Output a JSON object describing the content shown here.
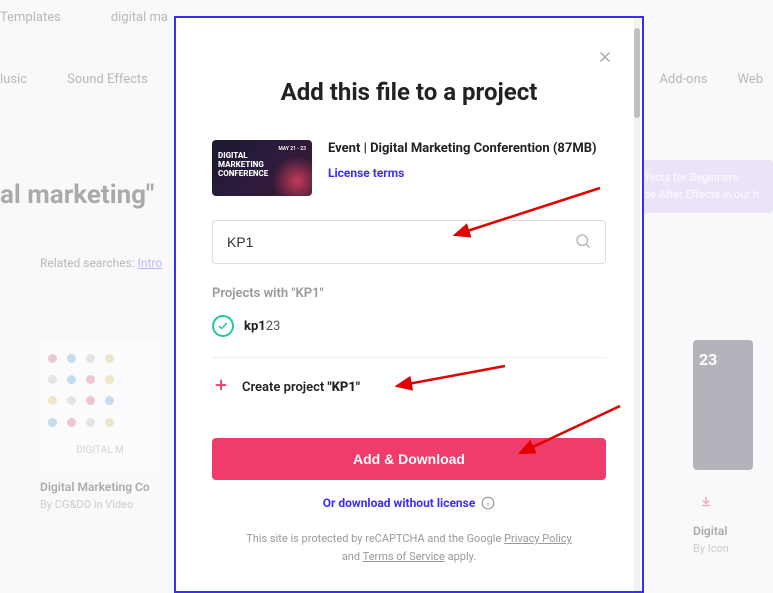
{
  "bg": {
    "nav1": [
      "Templates",
      "digital ma"
    ],
    "nav2": [
      "lusic",
      "Sound Effects"
    ],
    "nav_right": [
      "Add-ons",
      "Web"
    ],
    "heading": "al marketing\"",
    "related_label": "Related searches:",
    "related_link": "Intro",
    "banner_line1": "r Effects for Beginners",
    "banner_line2": "o use After Effects in our h",
    "card_left_thumb": "DIGITAL M",
    "card_left_title": "Digital Marketing Co",
    "card_left_sub": "By CG&DO in Video",
    "card_right_num": "23",
    "card_right_title": "Digital",
    "card_right_sub": "By Icon"
  },
  "modal": {
    "title": "Add this file to a project",
    "file_name": "Event | Digital Marketing Conferention (87MB)",
    "thumb_text": "DIGITAL\nMARKETING\nCONFERENCE",
    "thumb_date": "MAY 21 - 23",
    "license_link": "License terms",
    "search_value": "KP1",
    "projects_label": "Projects with \"KP1\"",
    "project_match_prefix": "kp1",
    "project_match_suffix": "23",
    "create_prefix": "Create project ",
    "create_name": "\"KP1\"",
    "primary_btn": "Add & Download",
    "alt_download": "Or download without license",
    "recaptcha_pre": "This site is protected by reCAPTCHA and the Google ",
    "recaptcha_pp": "Privacy Policy",
    "recaptcha_mid": " and ",
    "recaptcha_tos": "Terms of Service",
    "recaptcha_post": " apply."
  }
}
